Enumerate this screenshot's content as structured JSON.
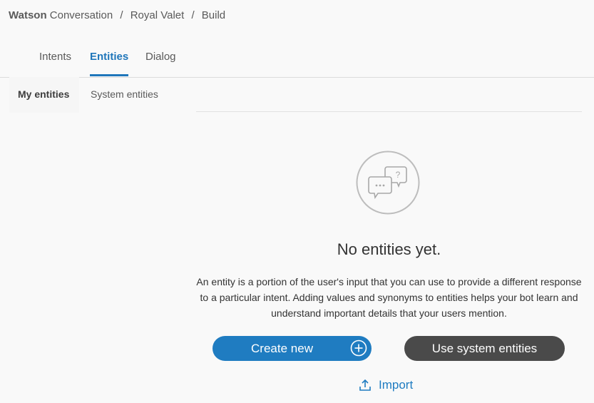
{
  "breadcrumb": {
    "brand_bold": "Watson",
    "brand_rest": " Conversation",
    "separator": "/",
    "workspace": "Royal Valet",
    "page": "Build"
  },
  "main_tabs": [
    {
      "label": "Intents"
    },
    {
      "label": "Entities"
    },
    {
      "label": "Dialog"
    }
  ],
  "main_tabs_active": "Entities",
  "sub_tabs": [
    {
      "label": "My entities"
    },
    {
      "label": "System entities"
    }
  ],
  "sub_tabs_active": "My entities",
  "empty_state": {
    "icon": "chat-question-icon",
    "title": "No entities yet.",
    "description": "An entity is a portion of the user's input that you can use to provide a different response to a particular intent. Adding values and synonyms to entities helps your bot learn and understand important details that your users mention."
  },
  "actions": {
    "create_new": "Create new",
    "use_system": "Use system entities",
    "import": "Import"
  },
  "colors": {
    "accent": "#1f7cc1",
    "dark_button": "#4a4a4a",
    "background": "#f9f9f9"
  }
}
